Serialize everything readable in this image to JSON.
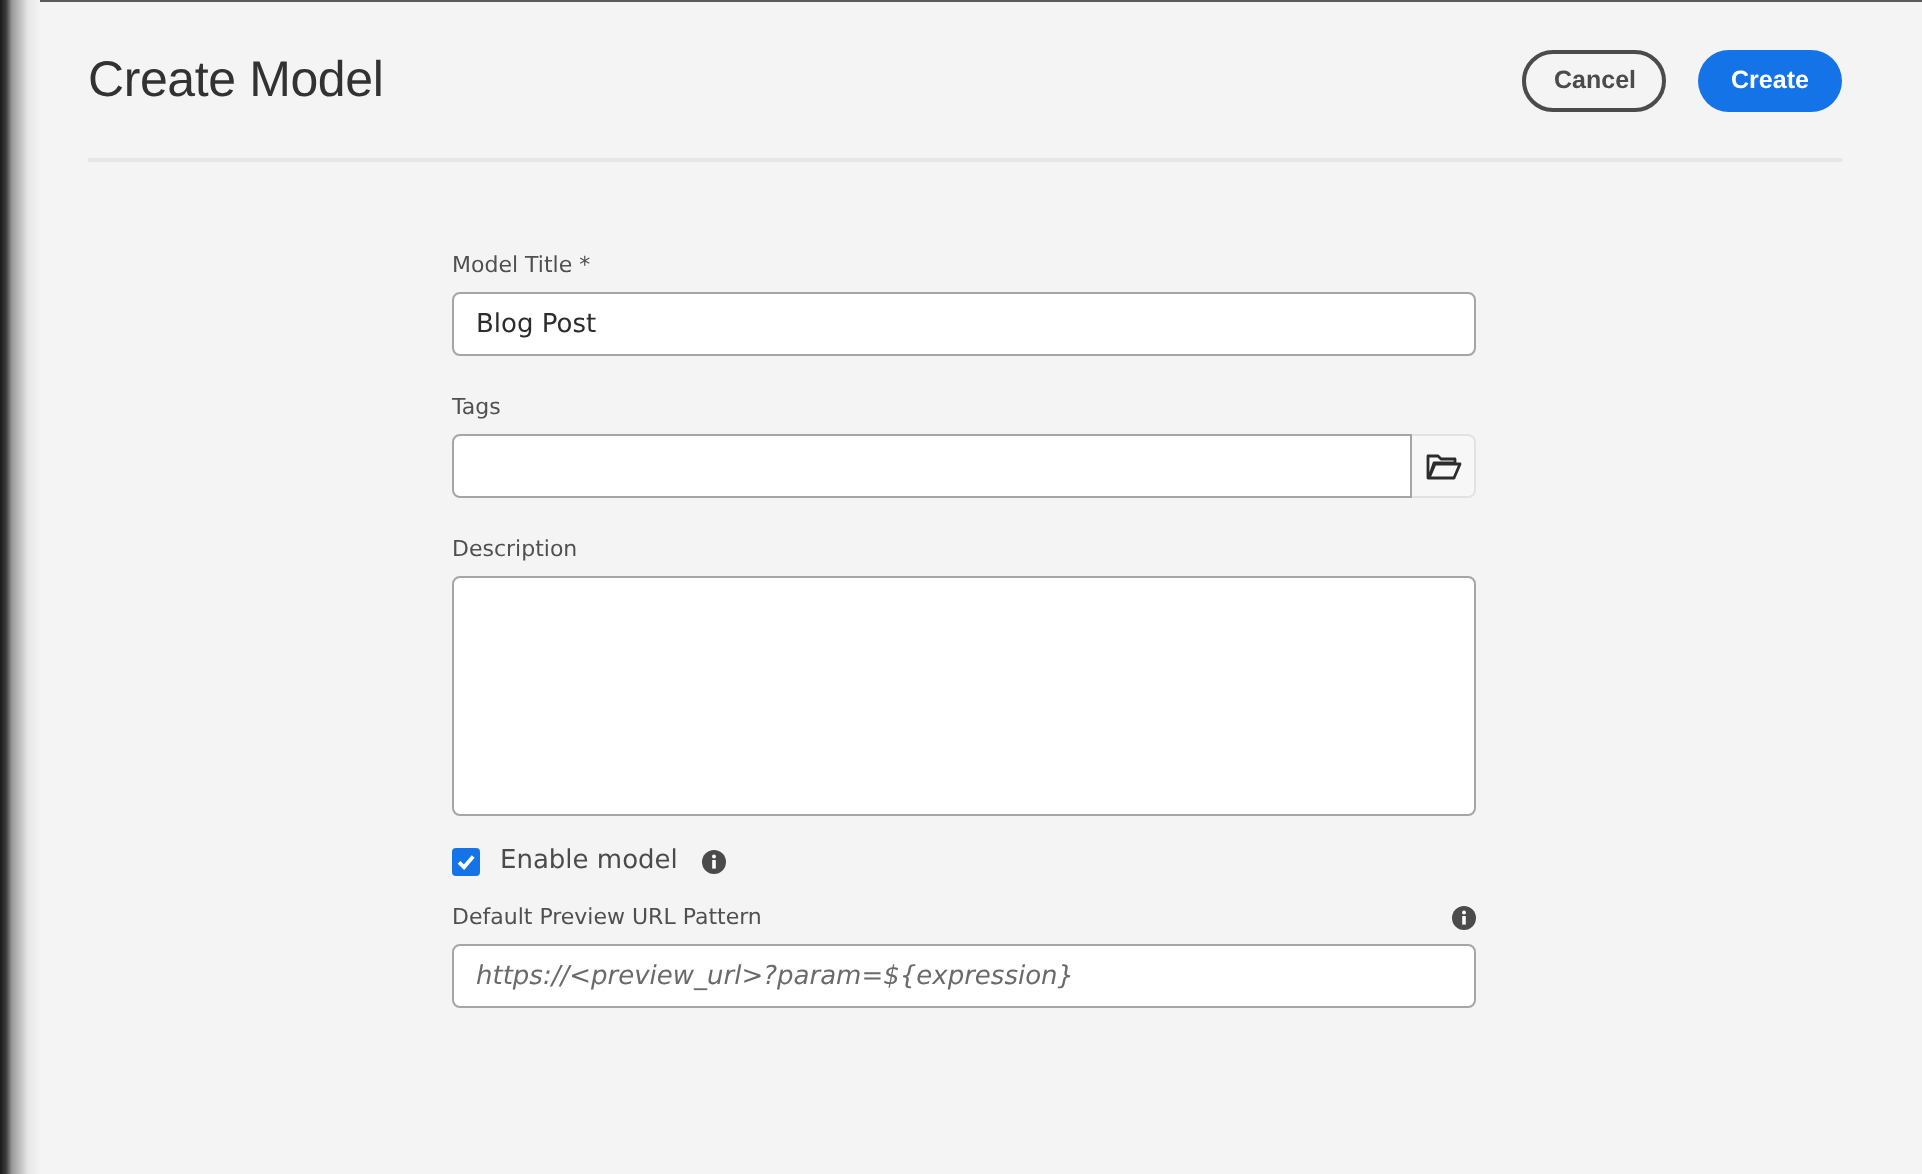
{
  "header": {
    "title": "Create Model",
    "buttons": [
      {
        "label": "Cancel",
        "kind": "secondary"
      },
      {
        "label": "Create",
        "kind": "primary"
      }
    ]
  },
  "fields": [
    {
      "kind": "text",
      "label": "Model Title *",
      "value": "Blog Post"
    },
    {
      "kind": "picker",
      "label": "Tags"
    },
    {
      "kind": "textarea",
      "label": "Description"
    },
    {
      "kind": "checkbox",
      "label": "Enable model",
      "checked": true,
      "info": true
    },
    {
      "kind": "text",
      "label": "Default Preview URL Pattern",
      "placeholder": "https://<preview_url>?param=${expression}",
      "info": true
    }
  ]
}
